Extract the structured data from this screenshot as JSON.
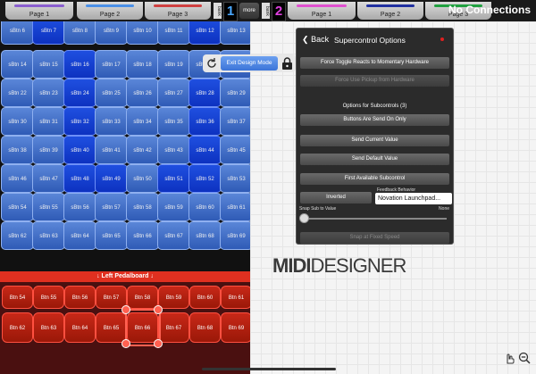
{
  "topbar": {
    "left_tabs": [
      "Page 1",
      "Page 2",
      "Page 3"
    ],
    "left_tab_colors": [
      "#8a5fd0",
      "#4a90e8",
      "#d04040"
    ],
    "bank_label": "bank",
    "bank_left_num": "1",
    "more_label": "more",
    "bank_right_num": "2",
    "right_tabs": [
      "Page 1",
      "Page 2",
      "Page 3"
    ],
    "right_tab_colors": [
      "#e050d0",
      "#2030a0",
      "#20a040"
    ],
    "status": "No Connections"
  },
  "grid_rows": [
    [
      "sBtn 6",
      "sBtn 7",
      "sBtn 8",
      "sBtn 9",
      "sBtn 10",
      "sBtn 11",
      "sBtn 12",
      "sBtn 13"
    ],
    [
      "sBtn 14",
      "sBtn 15",
      "sBtn 16",
      "sBtn 17",
      "sBtn 18",
      "sBtn 19",
      "sBtn 20",
      "sBtn 21"
    ],
    [
      "sBtn 22",
      "sBtn 23",
      "sBtn 24",
      "sBtn 25",
      "sBtn 26",
      "sBtn 27",
      "sBtn 28",
      "sBtn 29"
    ],
    [
      "sBtn 30",
      "sBtn 31",
      "sBtn 32",
      "sBtn 33",
      "sBtn 34",
      "sBtn 35",
      "sBtn 36",
      "sBtn 37"
    ],
    [
      "sBtn 38",
      "sBtn 39",
      "sBtn 40",
      "sBtn 41",
      "sBtn 42",
      "sBtn 43",
      "sBtn 44",
      "sBtn 45"
    ],
    [
      "sBtn 46",
      "sBtn 47",
      "sBtn 48",
      "sBtn 49",
      "sBtn 50",
      "sBtn 51",
      "sBtn 52",
      "sBtn 53"
    ],
    [
      "sBtn 54",
      "sBtn 55",
      "sBtn 56",
      "sBtn 57",
      "sBtn 58",
      "sBtn 59",
      "sBtn 60",
      "sBtn 61"
    ],
    [
      "sBtn 62",
      "sBtn 63",
      "sBtn 64",
      "sBtn 65",
      "sBtn 66",
      "sBtn 67",
      "sBtn 68",
      "sBtn 69"
    ]
  ],
  "active_buttons": [
    "sBtn 7",
    "sBtn 12",
    "sBtn 16",
    "sBtn 24",
    "sBtn 28",
    "sBtn 32",
    "sBtn 36",
    "sBtn 40",
    "sBtn 44",
    "sBtn 48",
    "sBtn 49",
    "sBtn 51",
    "sBtn 52"
  ],
  "pedalboard": {
    "title": "↓ Left Pedalboard ↓",
    "row1": [
      "Btn 54",
      "Btn 55",
      "Btn 56",
      "Btn 57",
      "Btn 58",
      "Btn 59",
      "Btn 60",
      "Btn 61"
    ],
    "row2": [
      "Btn 62",
      "Btn 63",
      "Btn 64",
      "Btn 65",
      "Btn 66",
      "Btn 67",
      "Btn 68",
      "Btn 69"
    ]
  },
  "design": {
    "exit_label": "Exit Design Mode"
  },
  "panel": {
    "back": "Back",
    "title": "Supercontrol Options",
    "force_toggle": "Force Toggle Reacts to Momentary Hardware",
    "force_pickup": "Force Use Pickup from Hardware",
    "subcontrols_label": "Options for Subcontrols (3)",
    "buttons_send": "Buttons Are Send On Only",
    "send_current": "Send Current Value",
    "send_default": "Send Default Value",
    "first_available": "First Available Subcontrol",
    "inverted": "Inverted",
    "feedback_label": "Feedback Behavior",
    "feedback_value": "Novation Launchpad...",
    "snap_label": "Snap Sub to Value",
    "snap_value": "None",
    "snap_fraction": 0,
    "last_button": "Snap at Fixed Speed"
  },
  "logo": {
    "part1": "MIDI",
    "part2": "DESIGNER"
  }
}
